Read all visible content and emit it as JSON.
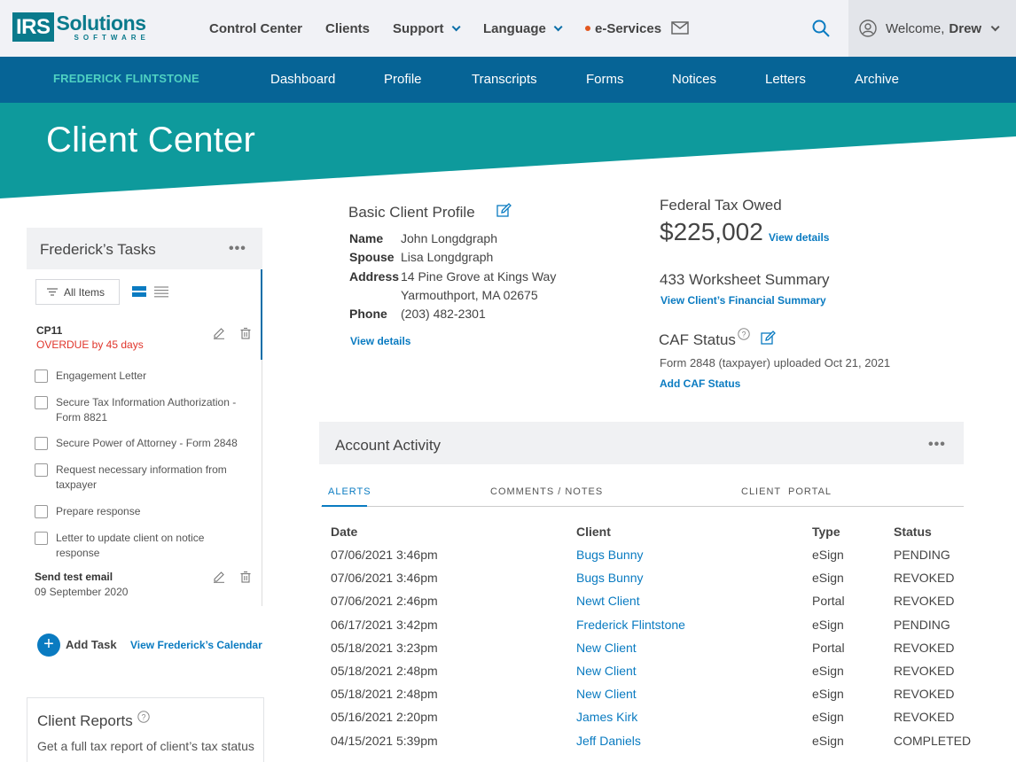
{
  "brand": {
    "mark": "IRS",
    "name": "Solutions",
    "tagline": "SOFTWARE"
  },
  "topnav": {
    "control_center": "Control Center",
    "clients": "Clients",
    "support": "Support",
    "language": "Language",
    "eservices": "e-Services",
    "welcome": "Welcome,",
    "user": "Drew"
  },
  "client_nav": {
    "client_name": "FREDERICK FLINTSTONE",
    "items": [
      "Dashboard",
      "Profile",
      "Transcripts",
      "Forms",
      "Notices",
      "Letters",
      "Archive"
    ]
  },
  "banner": {
    "title": "Client Center"
  },
  "tasks": {
    "title": "Frederick’s Tasks",
    "menu": "•••",
    "filter_label": "All Items",
    "group1": {
      "title": "CP11",
      "status": "OVERDUE by 45 days",
      "items": [
        "Engagement Letter",
        "Secure Tax Information Authorization - Form 8821",
        "Secure Power of Attorney - Form 2848",
        "Request necessary information from taxpayer",
        "Prepare response",
        "Letter to update client on notice response"
      ]
    },
    "group2": {
      "title": "Send test email",
      "date": "09 September 2020"
    },
    "add_task": "Add Task",
    "calendar_link": "View Frederick’s Calendar"
  },
  "reports": {
    "title": "Client Reports",
    "description": "Get a full tax report of client’s tax status"
  },
  "profile": {
    "title": "Basic Client Profile",
    "name_label": "Name",
    "name": "John Longdgraph",
    "spouse_label": "Spouse",
    "spouse": "Lisa Longdgraph",
    "address_label": "Address",
    "address1": "14 Pine Grove at Kings Way",
    "address2": "Yarmouthport, MA 02675",
    "phone_label": "Phone",
    "phone": "(203) 482-2301",
    "view_details": "View details"
  },
  "federal": {
    "title": "Federal Tax Owed",
    "amount": "$225,002",
    "view_details": "View details",
    "worksheet_title": "433 Worksheet Summary",
    "worksheet_link": "View Client’s Financial Summary",
    "caf_title": "CAF Status",
    "caf_desc": "Form 2848 (taxpayer) uploaded Oct 21, 2021",
    "caf_link": "Add CAF Status"
  },
  "activity": {
    "title": "Account Activity",
    "menu": "•••",
    "tabs": [
      "ALERTS",
      "COMMENTS / NOTES",
      "CLIENT  PORTAL"
    ],
    "columns": [
      "Date",
      "Client",
      "Type",
      "Status"
    ],
    "rows": [
      {
        "date": "07/06/2021 3:46pm",
        "client": "Bugs Bunny",
        "type": "eSign",
        "status": "PENDING"
      },
      {
        "date": "07/06/2021 3:46pm",
        "client": "Bugs Bunny",
        "type": "eSign",
        "status": "REVOKED"
      },
      {
        "date": "07/06/2021 2:46pm",
        "client": "Newt Client",
        "type": "Portal",
        "status": "REVOKED"
      },
      {
        "date": "06/17/2021 3:42pm",
        "client": "Frederick Flintstone",
        "type": "eSign",
        "status": "PENDING"
      },
      {
        "date": "05/18/2021 3:23pm",
        "client": "New Client",
        "type": "Portal",
        "status": "REVOKED"
      },
      {
        "date": "05/18/2021 2:48pm",
        "client": "New Client",
        "type": "eSign",
        "status": "REVOKED"
      },
      {
        "date": "05/18/2021 2:48pm",
        "client": "New Client",
        "type": "eSign",
        "status": "REVOKED"
      },
      {
        "date": "05/16/2021 2:20pm",
        "client": "James Kirk",
        "type": "eSign",
        "status": "REVOKED"
      },
      {
        "date": "04/15/2021 5:39pm",
        "client": "Jeff Daniels",
        "type": "eSign",
        "status": "COMPLETED"
      }
    ]
  },
  "colors": {
    "header_bg": "#f1f2f6",
    "nav_blue": "#066496",
    "teal": "#0e9a9c",
    "link_blue": "#0a7bc1",
    "overdue_red": "#e0352b"
  }
}
